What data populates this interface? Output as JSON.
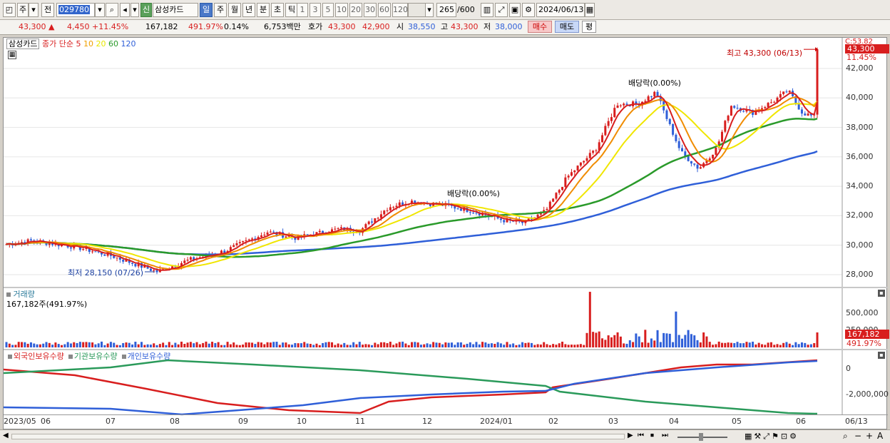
{
  "toolbar": {
    "period_btn": "주",
    "prev_btn": "전",
    "stock_code": "029780",
    "credit_badge": "신",
    "stock_name": "삼성카드",
    "timeframes": [
      "일",
      "주",
      "월",
      "년",
      "분",
      "초",
      "틱"
    ],
    "intervals": [
      "1",
      "3",
      "5",
      "10",
      "20",
      "30",
      "60",
      "120"
    ],
    "range": "265",
    "range_total": "/600",
    "date": "2024/06/13"
  },
  "quote": {
    "price": "43,300 ▲",
    "change": "4,450 +11.45%",
    "volume": "167,182",
    "volume_ratio": "491.97%",
    "turnover_rate": "0.14%",
    "amount": "6,753백만",
    "ask_label": "호가",
    "ask1": "43,300",
    "ask2": "42,900",
    "open_label": "시",
    "open": "38,550",
    "high_label": "고",
    "high": "43,300",
    "low_label": "저",
    "low": "38,000",
    "buy_btn": "매수",
    "sell_btn": "매도",
    "eval_btn": "평"
  },
  "price_panel": {
    "legend_name": "삼성카드",
    "legend_ma_label": "종가 단순",
    "ma_periods": [
      {
        "period": "5",
        "color": "#d81e1e"
      },
      {
        "period": "10",
        "color": "#f0a000"
      },
      {
        "period": "20",
        "color": "#e8e800"
      },
      {
        "period": "60",
        "color": "#2a9a2a"
      },
      {
        "period": "120",
        "color": "#2f5fd8"
      }
    ],
    "y_ticks": [
      "42,000",
      "40,000",
      "38,000",
      "36,000",
      "34,000",
      "32,000",
      "30,000",
      "28,000"
    ],
    "last_price_tag": "43,300",
    "last_price_pct": "11.45%",
    "change_top": "C:53.82",
    "high_annotation": "최고 43,300 (06/13)",
    "low_annotation": "최저 28,150 (07/26)",
    "dividend_1": "배당락(0.00%)",
    "dividend_2": "배당락(0.00%)"
  },
  "volume_panel": {
    "title": "거래량",
    "value": "167,182주(491.97%)",
    "y_ticks": [
      "500,000",
      "250,000"
    ],
    "tag": "167,182",
    "tag_pct": "491.97%"
  },
  "holdings_panel": {
    "legend": [
      {
        "label": "외국인보유수량",
        "color": "#d81e1e"
      },
      {
        "label": "기관보유수량",
        "color": "#2a9a5a"
      },
      {
        "label": "개인보유수량",
        "color": "#2f5fd8"
      }
    ],
    "y_ticks": [
      "0",
      "-2,000,000"
    ]
  },
  "x_axis": [
    "2023/05",
    "06",
    "07",
    "08",
    "09",
    "10",
    "11",
    "12",
    "2024/01",
    "02",
    "03",
    "04",
    "05",
    "06",
    "06/13"
  ],
  "colors": {
    "up": "#d81e1e",
    "down": "#2f5fd8"
  }
}
